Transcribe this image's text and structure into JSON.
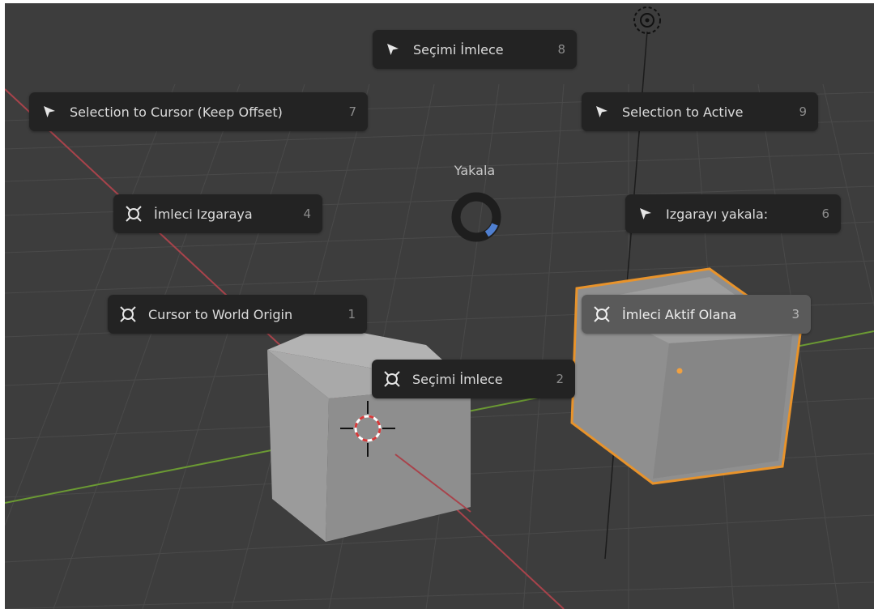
{
  "pie_menu": {
    "title": "Yakala",
    "items": [
      {
        "id": "item8",
        "label": "Seçimi İmlece",
        "key": "8",
        "icon": "pointer-arrow-icon"
      },
      {
        "id": "item7",
        "label": "Selection to Cursor (Keep Offset)",
        "key": "7",
        "icon": "pointer-arrow-icon"
      },
      {
        "id": "item9",
        "label": "Selection to Active",
        "key": "9",
        "icon": "pointer-arrow-icon"
      },
      {
        "id": "item4",
        "label": "İmleci Izgaraya",
        "key": "4",
        "icon": "cursor-target-icon"
      },
      {
        "id": "item6",
        "label": "Izgarayı yakala:",
        "key": "6",
        "icon": "pointer-arrow-icon"
      },
      {
        "id": "item1",
        "label": "Cursor to World Origin",
        "key": "1",
        "icon": "cursor-target-icon"
      },
      {
        "id": "item3",
        "label": "İmleci Aktif Olana",
        "key": "3",
        "icon": "cursor-target-icon",
        "active": true
      },
      {
        "id": "item2",
        "label": "Seçimi İmlece",
        "key": "2",
        "icon": "cursor-target-icon"
      }
    ]
  },
  "colors": {
    "viewport_bg": "#3d3d3d",
    "menu_item_bg": "#232323",
    "menu_item_active_bg": "#5a5a5a",
    "x_axis": "#a8434b",
    "y_axis": "#6b9a33",
    "selection_outline": "#e8932b",
    "pie_indicator": "#4f7fd0"
  }
}
